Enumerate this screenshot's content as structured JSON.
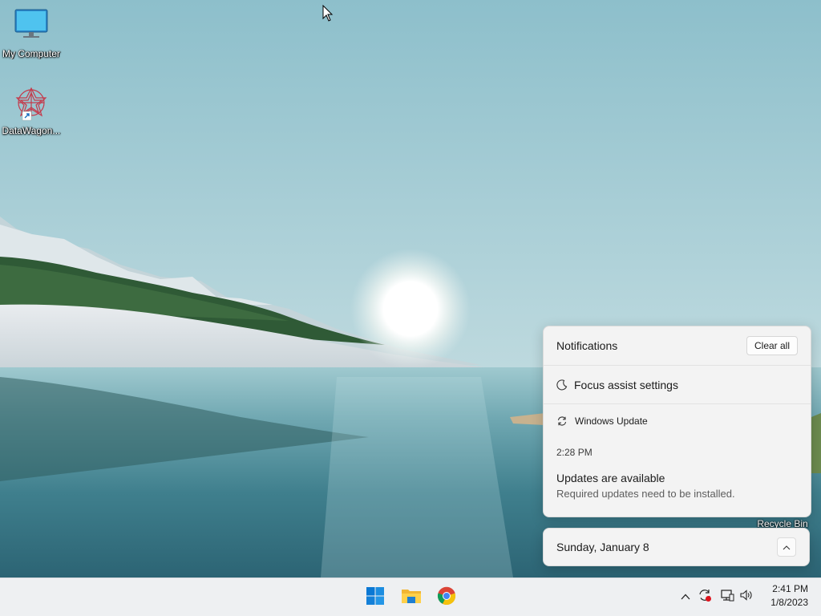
{
  "desktop": {
    "icons": [
      {
        "label": "My Computer",
        "icon": "monitor-icon"
      },
      {
        "label": "DataWagon...",
        "icon": "datawagon-app-icon"
      }
    ],
    "recycle_bin_label": "Recycle Bin"
  },
  "notification_center": {
    "title": "Notifications",
    "clear_all_label": "Clear all",
    "focus_assist_label": "Focus assist settings",
    "notification": {
      "app_name": "Windows Update",
      "time": "2:28 PM",
      "heading": "Updates are available",
      "body": "Required updates need to be installed."
    }
  },
  "calendar": {
    "date_label": "Sunday, January 8"
  },
  "taskbar": {
    "apps": [
      "windows-start-icon",
      "file-explorer-icon",
      "chrome-icon"
    ],
    "tray": [
      "chevron-up-icon",
      "update-restart-icon",
      "network-icon",
      "volume-icon"
    ],
    "clock": {
      "time": "2:41 PM",
      "date": "1/8/2023"
    }
  },
  "colors": {
    "accent": "#0078d4",
    "taskbar_bg": "#eef0f2",
    "panel_bg": "#f3f3f3"
  }
}
